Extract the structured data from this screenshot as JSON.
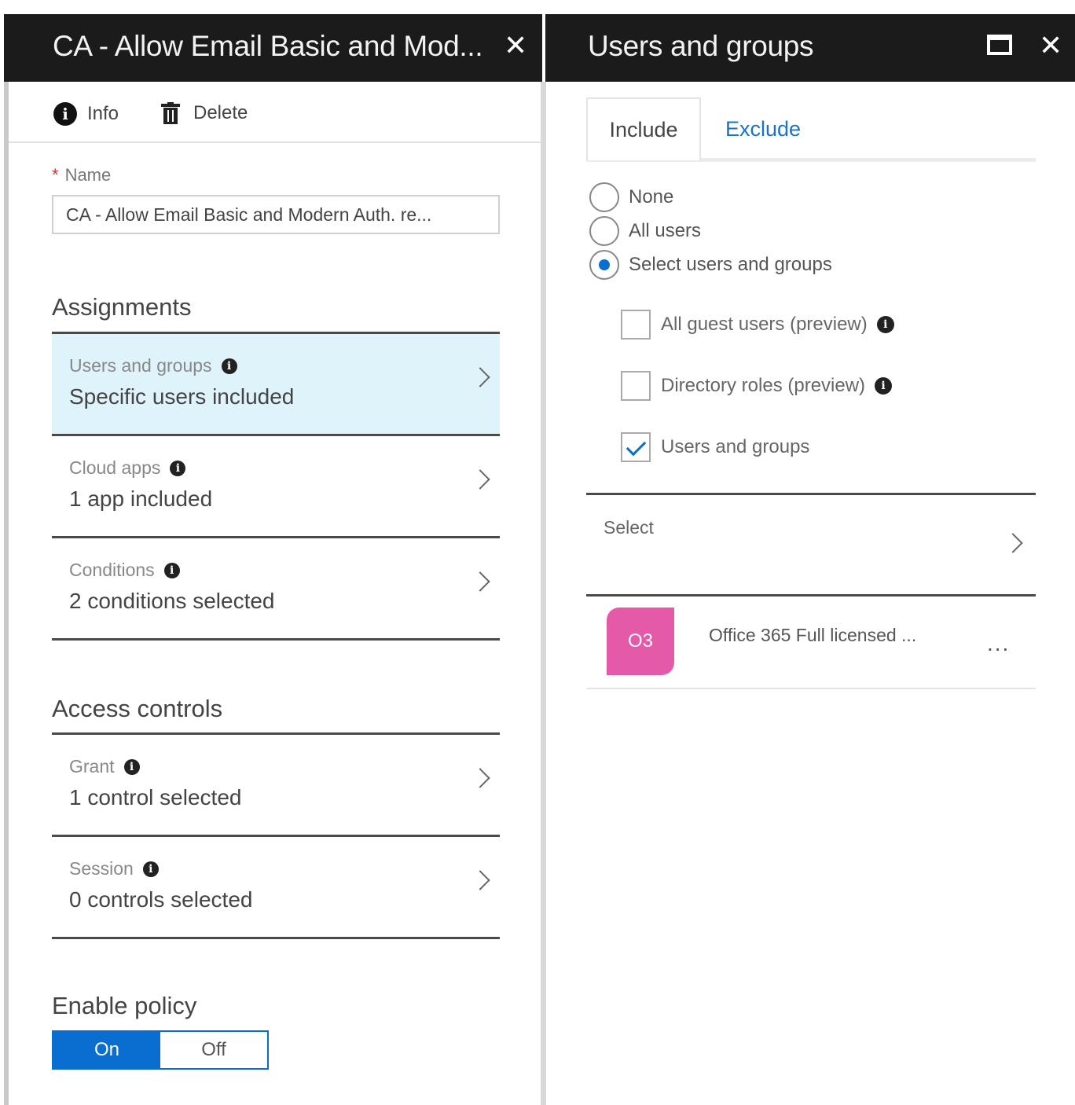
{
  "left_blade": {
    "title": "CA - Allow Email Basic and Mod...",
    "close_icon": "✕",
    "toolbar": {
      "info_label": "Info",
      "delete_label": "Delete"
    },
    "name": {
      "required_mark": "*",
      "label": "Name",
      "value": "CA - Allow Email Basic and Modern Auth. re..."
    },
    "assignments": {
      "title": "Assignments",
      "items": [
        {
          "title": "Users and groups",
          "subtitle": "Specific users included",
          "selected": true
        },
        {
          "title": "Cloud apps",
          "subtitle": "1 app included",
          "selected": false
        },
        {
          "title": "Conditions",
          "subtitle": "2 conditions selected",
          "selected": false
        }
      ]
    },
    "access_controls": {
      "title": "Access controls",
      "items": [
        {
          "title": "Grant",
          "subtitle": "1 control selected"
        },
        {
          "title": "Session",
          "subtitle": "0 controls selected"
        }
      ]
    },
    "enable_policy": {
      "title": "Enable policy",
      "on_label": "On",
      "off_label": "Off",
      "selected": "On"
    }
  },
  "right_blade": {
    "title": "Users and groups",
    "close_icon": "✕",
    "tabs": [
      {
        "label": "Include",
        "active": true
      },
      {
        "label": "Exclude",
        "active": false
      }
    ],
    "radios": [
      {
        "label": "None",
        "checked": false
      },
      {
        "label": "All users",
        "checked": false
      },
      {
        "label": "Select users and groups",
        "checked": true
      }
    ],
    "checkboxes": [
      {
        "label": "All guest users (preview)",
        "checked": false,
        "info": true
      },
      {
        "label": "Directory roles (preview)",
        "checked": false,
        "info": true
      },
      {
        "label": "Users and groups",
        "checked": true,
        "info": false
      }
    ],
    "select": {
      "label": "Select"
    },
    "members": [
      {
        "initials": "O3",
        "name": "Office 365 Full licensed ...",
        "more": "..."
      }
    ]
  },
  "colors": {
    "header_bg": "#1b1b1b",
    "accent": "#0a6ed1",
    "selected_row": "#dff3fa",
    "avatar": "#e55aa8"
  },
  "icons": [
    "info-icon",
    "trash-icon",
    "close-icon",
    "maximize-icon",
    "chevron-right-icon",
    "more-icon"
  ]
}
